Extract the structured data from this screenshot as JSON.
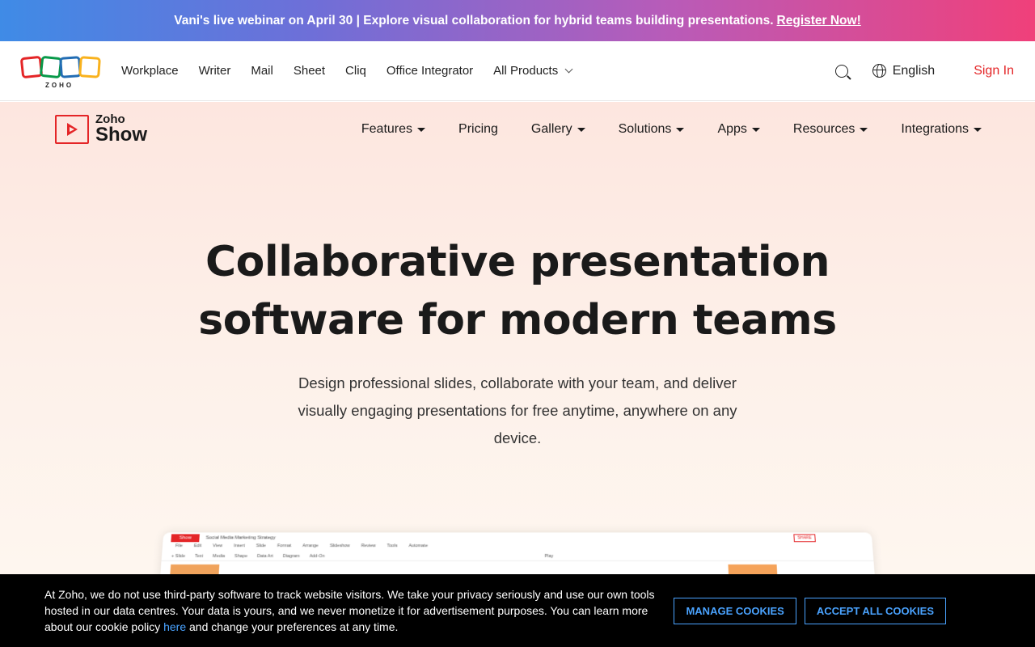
{
  "banner": {
    "text": "Vani's live webinar on April 30 | Explore visual collaboration for hybrid teams building presentations.",
    "link": "Register Now!"
  },
  "topnav": {
    "logo_text": "ZOHO",
    "links": [
      "Workplace",
      "Writer",
      "Mail",
      "Sheet",
      "Cliq",
      "Office Integrator",
      "All Products"
    ],
    "language": "English",
    "signin": "Sign In"
  },
  "show_nav": {
    "brand_top": "Zoho",
    "brand_bottom": "Show",
    "menu": [
      {
        "label": "Features",
        "dropdown": true
      },
      {
        "label": "Pricing",
        "dropdown": false
      },
      {
        "label": "Gallery",
        "dropdown": true
      },
      {
        "label": "Solutions",
        "dropdown": true
      },
      {
        "label": "Apps",
        "dropdown": true
      },
      {
        "label": "Resources",
        "dropdown": true
      },
      {
        "label": "Integrations",
        "dropdown": true
      }
    ]
  },
  "hero": {
    "title_line1": "Collaborative presentation",
    "title_line2": "software for modern teams",
    "subtitle": "Design professional slides, collaborate with your team, and deliver visually engaging presentations for free anytime, anywhere on any device."
  },
  "preview": {
    "app_label": "Show",
    "doc_title": "Social Media Marketing Strategy",
    "menu": [
      "File",
      "Edit",
      "View",
      "Insert",
      "Slide",
      "Format",
      "Arrange",
      "Slideshow",
      "Review",
      "Tools",
      "Automate"
    ],
    "toolbar": [
      "+ Slide",
      "Text",
      "Media",
      "Shape",
      "Data Art",
      "Diagram",
      "Add-On",
      "Play"
    ],
    "share": "SHARE"
  },
  "cookie": {
    "message_before": "At Zoho, we do not use third-party software to track website visitors. We take your privacy seriously and use our own tools hosted in our data centres. Your data is yours, and we never monetize it for advertisement purposes. You can learn more about our cookie policy ",
    "link": "here",
    "message_after": " and change your preferences at any time.",
    "manage": "MANAGE COOKIES",
    "accept": "ACCEPT ALL COOKIES"
  },
  "colors": {
    "brand_red": "#e42527",
    "link_blue": "#4aa3ff"
  }
}
